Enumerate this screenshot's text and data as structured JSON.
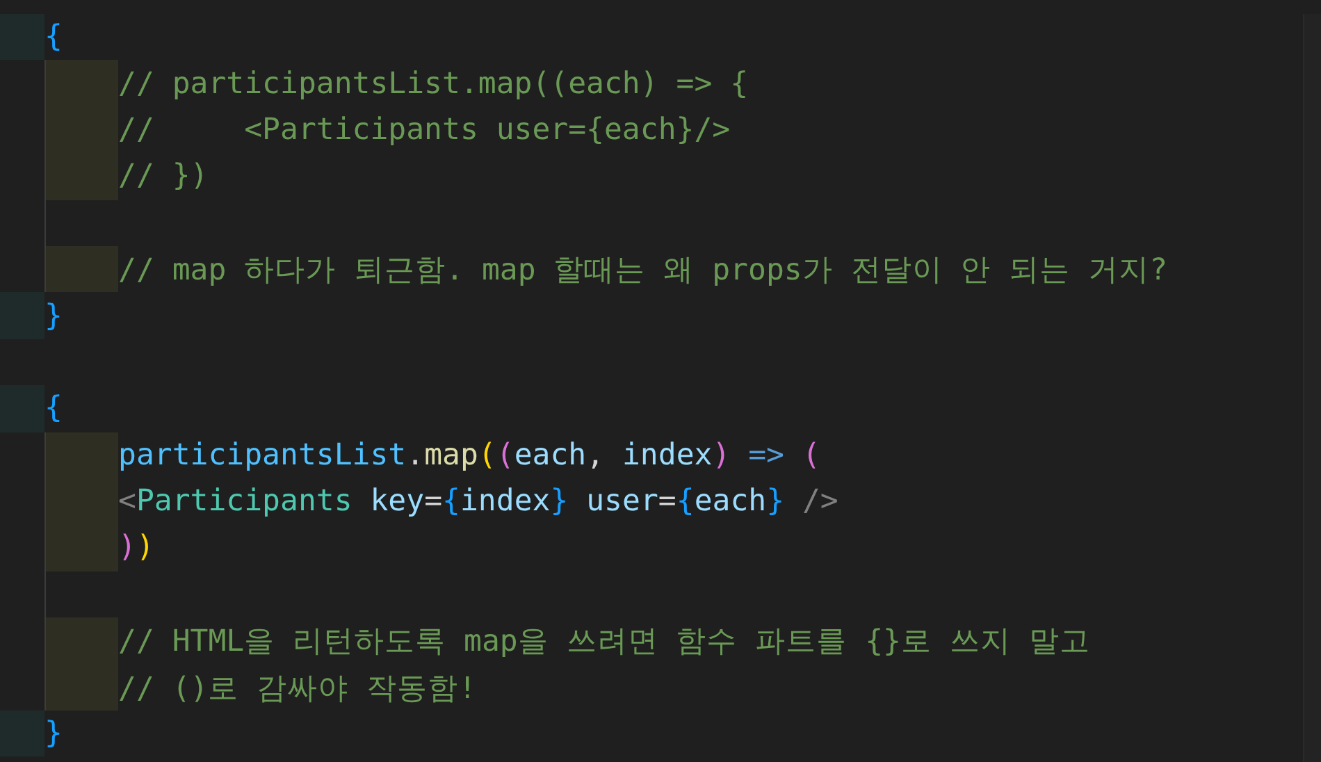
{
  "blocks": [
    {
      "open": "{",
      "close": "}",
      "lines": [
        {
          "kind": "comment",
          "text": "// participantsList.map((each) => {"
        },
        {
          "kind": "comment",
          "text": "//     <Participants user={each}/>"
        },
        {
          "kind": "comment",
          "text": "// })"
        },
        {
          "kind": "blank"
        },
        {
          "kind": "comment",
          "text": "// map 하다가 퇴근함. map 할때는 왜 props가 전달이 안 되는 거지?"
        }
      ]
    },
    {
      "open": "{",
      "close": "}",
      "lines": [
        {
          "kind": "code",
          "tokens": [
            {
              "text": "participantsList",
              "kind": "constant"
            },
            {
              "text": ".",
              "kind": "punct"
            },
            {
              "text": "map",
              "kind": "function"
            },
            {
              "text": "(",
              "kind": "bracket1"
            },
            {
              "text": "(",
              "kind": "bracket2"
            },
            {
              "text": "each",
              "kind": "variable"
            },
            {
              "text": ", ",
              "kind": "punct"
            },
            {
              "text": "index",
              "kind": "variable"
            },
            {
              "text": ")",
              "kind": "bracket2"
            },
            {
              "text": " => ",
              "kind": "keyword"
            },
            {
              "text": "(",
              "kind": "bracket2"
            }
          ]
        },
        {
          "kind": "code",
          "tokens": [
            {
              "text": "<",
              "kind": "tag"
            },
            {
              "text": "Participants",
              "kind": "component"
            },
            {
              "text": " key",
              "kind": "variable"
            },
            {
              "text": "=",
              "kind": "punct"
            },
            {
              "text": "{",
              "kind": "bracket3"
            },
            {
              "text": "index",
              "kind": "variable"
            },
            {
              "text": "}",
              "kind": "bracket3"
            },
            {
              "text": " user",
              "kind": "variable"
            },
            {
              "text": "=",
              "kind": "punct"
            },
            {
              "text": "{",
              "kind": "bracket3"
            },
            {
              "text": "each",
              "kind": "variable"
            },
            {
              "text": "}",
              "kind": "bracket3"
            },
            {
              "text": " />",
              "kind": "tag"
            }
          ]
        },
        {
          "kind": "code",
          "tokens": [
            {
              "text": ")",
              "kind": "bracket2"
            },
            {
              "text": ")",
              "kind": "bracket1"
            }
          ]
        },
        {
          "kind": "blank"
        },
        {
          "kind": "comment",
          "text": "// HTML을 리턴하도록 map을 쓰려면 함수 파트를 {}로 쓰지 말고"
        },
        {
          "kind": "comment",
          "text": "// ()로 감싸야 작동함!"
        }
      ]
    }
  ]
}
